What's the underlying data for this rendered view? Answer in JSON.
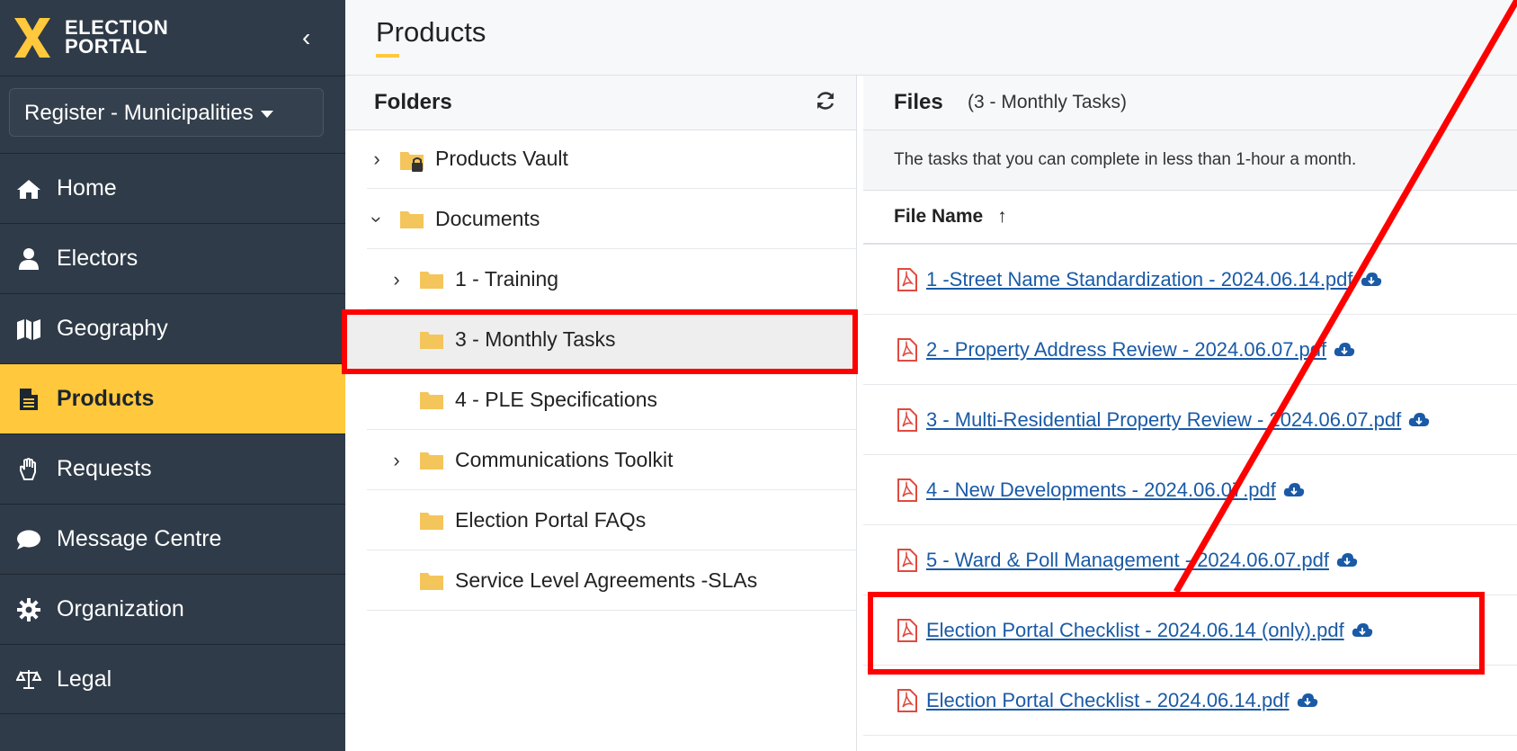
{
  "brand": {
    "line1": "ELECTION",
    "line2": "PORTAL",
    "accent": "#ffc83d"
  },
  "register_select": {
    "value": "Register - Municipalities"
  },
  "nav": [
    {
      "label": "Home",
      "icon": "home-icon",
      "active": false
    },
    {
      "label": "Electors",
      "icon": "user-icon",
      "active": false
    },
    {
      "label": "Geography",
      "icon": "map-icon",
      "active": false
    },
    {
      "label": "Products",
      "icon": "document-icon",
      "active": true
    },
    {
      "label": "Requests",
      "icon": "hand-icon",
      "active": false
    },
    {
      "label": "Message Centre",
      "icon": "chat-icon",
      "active": false
    },
    {
      "label": "Organization",
      "icon": "gear-icon",
      "active": false
    },
    {
      "label": "Legal",
      "icon": "scale-icon",
      "active": false
    }
  ],
  "page": {
    "title": "Products"
  },
  "folders": {
    "heading": "Folders",
    "items": [
      {
        "label": "Products Vault",
        "expander": ">",
        "locked": true
      },
      {
        "label": "Documents",
        "expander": "v"
      },
      {
        "label": "1 - Training",
        "expander": ">"
      },
      {
        "label": "3 - Monthly Tasks",
        "selected": true
      },
      {
        "label": "4 - PLE Specifications"
      },
      {
        "label": "Communications Toolkit",
        "expander": ">"
      },
      {
        "label": "Election Portal FAQs"
      },
      {
        "label": "Service Level Agreements -SLAs"
      }
    ]
  },
  "files": {
    "heading": "Files",
    "subheading": "(3 - Monthly Tasks)",
    "description": "The tasks that you can complete in less than 1-hour a month.",
    "column": "File Name",
    "sort_indicator": "↑",
    "items": [
      "1 -Street Name Standardization - 2024.06.14.pdf",
      "2 - Property Address Review - 2024.06.07.pdf",
      "3 - Multi-Residential Property Review - 2024.06.07.pdf",
      "4 - New Developments - 2024.06.07.pdf",
      "5 - Ward & Poll Management - 2024.06.07.pdf",
      "Election Portal Checklist - 2024.06.14 (only).pdf",
      "Election Portal Checklist - 2024.06.14.pdf"
    ]
  }
}
